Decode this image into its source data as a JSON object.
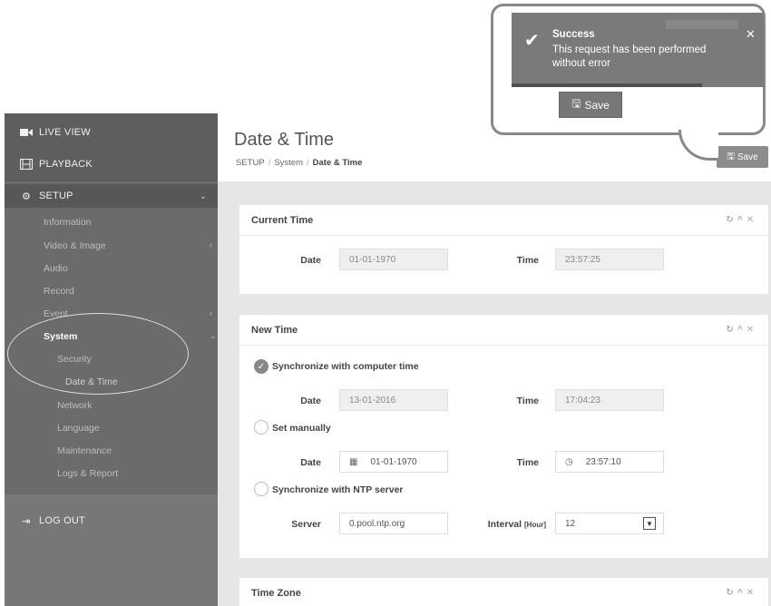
{
  "sidebar": {
    "live_view": "LIVE VIEW",
    "playback": "PLAYBACK",
    "setup": "SETUP",
    "items": [
      "Information",
      "Video & Image",
      "Audio",
      "Record",
      "Event",
      "System"
    ],
    "system_items": [
      "Security",
      "Network",
      "Language",
      "Maintenance",
      "Logs & Report"
    ],
    "date_time": "Date & Time",
    "logout": "LOG OUT"
  },
  "header": {
    "title": "Date & Time",
    "breadcrumb": [
      "SETUP",
      "System",
      "Date & Time"
    ],
    "save_label": "Save"
  },
  "current_time": {
    "title": "Current Time",
    "date_label": "Date",
    "date_value": "01-01-1970",
    "time_label": "Time",
    "time_value": "23:57:25"
  },
  "new_time": {
    "title": "New Time",
    "sync_computer_label": "Synchronize with computer time",
    "date_label": "Date",
    "time_label": "Time",
    "sync_date": "13-01-2016",
    "sync_time": "17:04:23",
    "manual_label": "Set manually",
    "manual_date": "01-01-1970",
    "manual_time": "23:57:10",
    "ntp_label": "Synchronize with NTP server",
    "server_label": "Server",
    "server_value": "0.pool.ntp.org",
    "interval_label": "Interval",
    "interval_unit": "[Hour]",
    "interval_value": "12"
  },
  "time_zone": {
    "title": "Time Zone"
  },
  "toast": {
    "title": "Success",
    "message": "This request has been performed without error",
    "save_label": "Save"
  }
}
